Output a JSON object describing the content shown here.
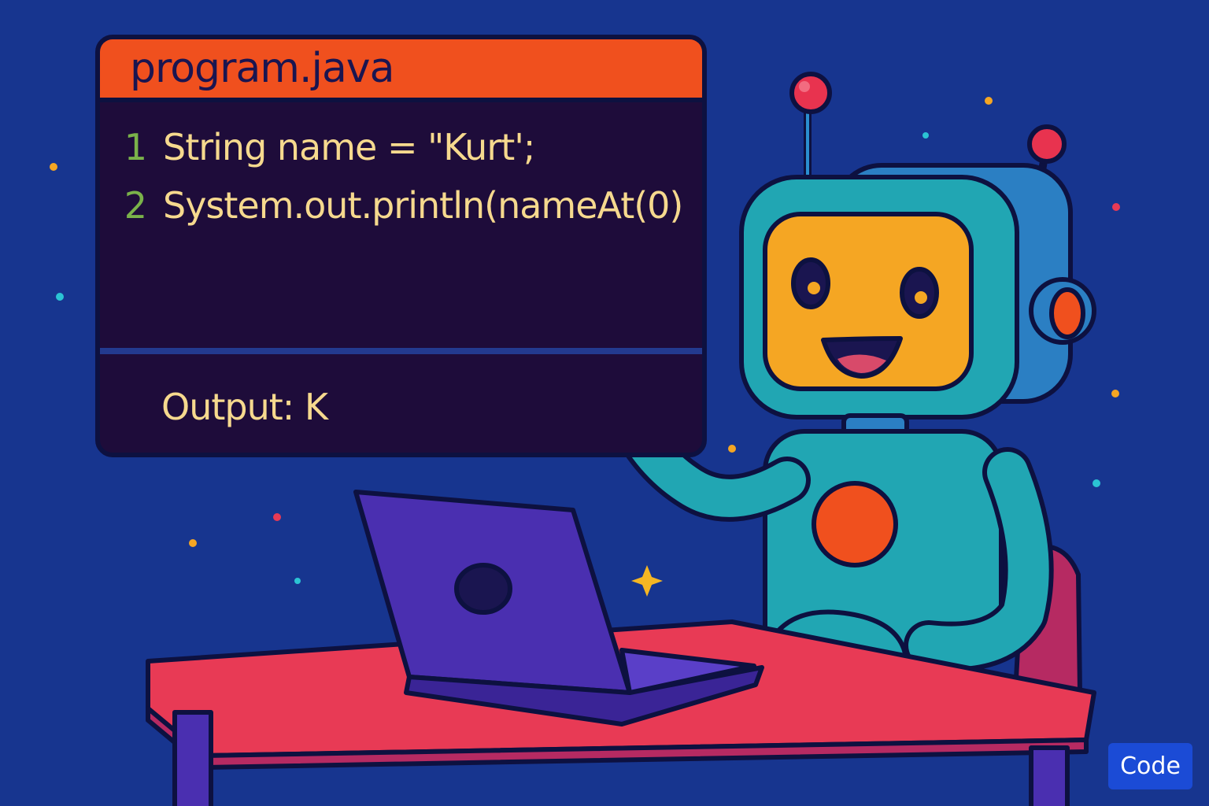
{
  "editor": {
    "filename": "program.java",
    "lines": [
      {
        "number": "1",
        "code": "String name = \"Kurt';"
      },
      {
        "number": "2",
        "code": "System.out.println(nameAt(0)"
      }
    ],
    "output": "Output: K"
  },
  "button": {
    "label": "Code"
  },
  "colors": {
    "background": "#17358f",
    "editor_header": "#f0501e",
    "editor_body": "#1e0c3a",
    "code_text": "#f6d98e",
    "line_numbers": "#7ab24a",
    "robot_body": "#21a6b3",
    "robot_face": "#f5a623",
    "desk": "#e83a55",
    "laptop": "#4a2fb0",
    "button": "#1b4bd6"
  },
  "icons": [
    "robot-illustration",
    "laptop-illustration",
    "desk-illustration",
    "sparkle-icon",
    "star-dot-icon"
  ]
}
